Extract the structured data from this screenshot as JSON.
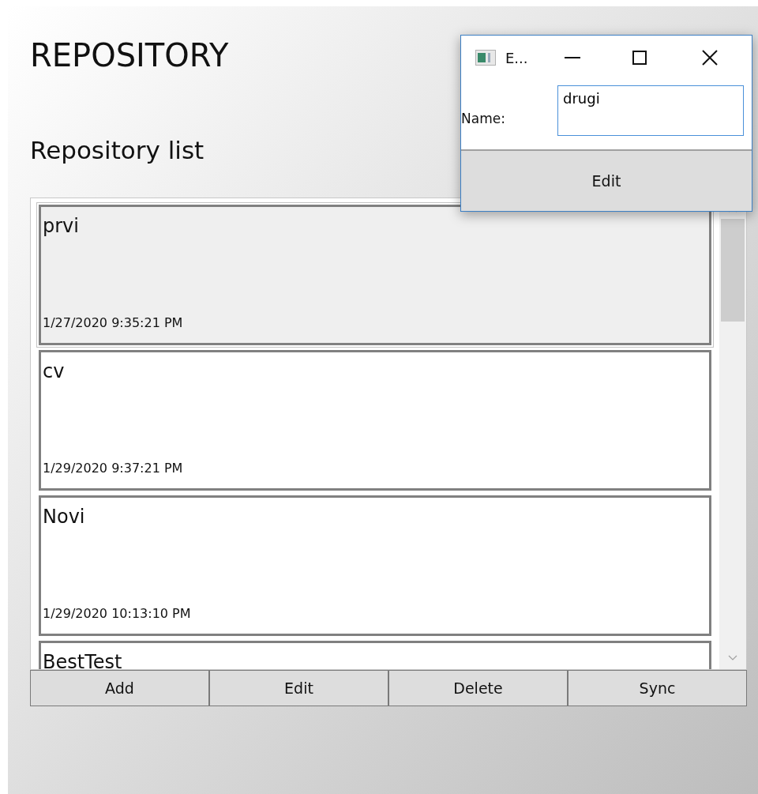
{
  "window": {
    "title": "REPOSITORY"
  },
  "section_title": "Repository list",
  "repositories": [
    {
      "name": "prvi",
      "date": "1/27/2020 9:35:21 PM",
      "selected": true
    },
    {
      "name": "cv",
      "date": "1/29/2020 9:37:21 PM",
      "selected": false
    },
    {
      "name": "Novi",
      "date": "1/29/2020 10:13:10 PM",
      "selected": false
    },
    {
      "name": "BestTest",
      "selected": false
    }
  ],
  "buttons": [
    "Add",
    "Edit",
    "Delete",
    "Sync"
  ],
  "dialog": {
    "title": "E...",
    "name_label": "Name:",
    "name_value": "drugi",
    "button": "Edit"
  }
}
